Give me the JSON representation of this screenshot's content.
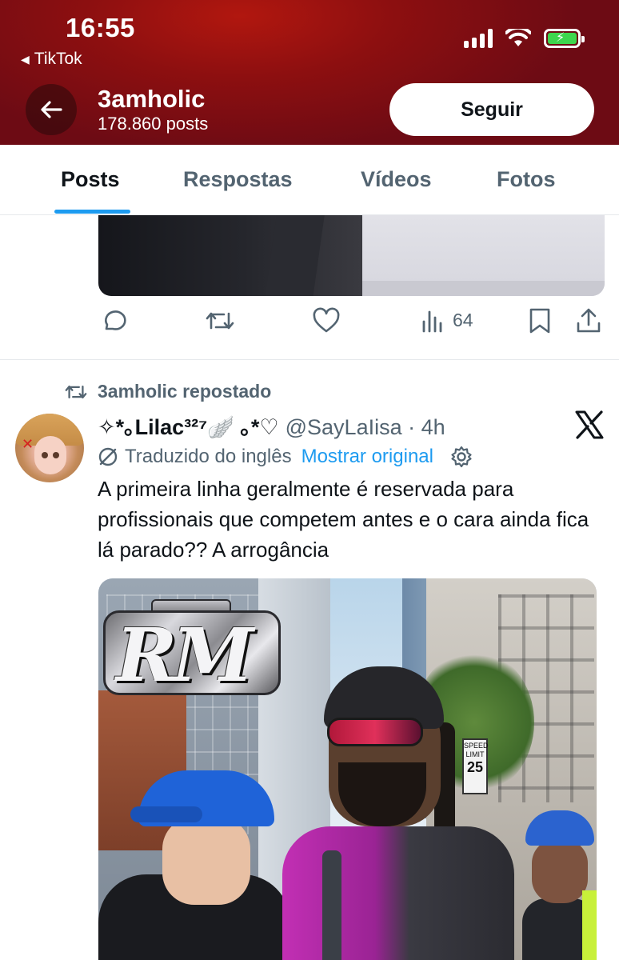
{
  "status_bar": {
    "time": "16:55",
    "back_app": "TikTok",
    "icons": [
      "cellular-signal-icon",
      "wifi-icon",
      "battery-charging-icon"
    ]
  },
  "header": {
    "back_icon": "arrow-left-icon",
    "name": "3amholic",
    "post_count": "178.860 posts",
    "follow_label": "Seguir"
  },
  "tabs": [
    {
      "label": "Posts",
      "active": true
    },
    {
      "label": "Respostas",
      "active": false
    },
    {
      "label": "Vídeos",
      "active": false
    },
    {
      "label": "Fotos",
      "active": false
    }
  ],
  "previous_post": {
    "actions": {
      "reply_icon": "reply-icon",
      "repost_icon": "repost-icon",
      "like_icon": "heart-icon",
      "views_icon": "views-icon",
      "views_count": "64",
      "bookmark_icon": "bookmark-icon",
      "share_icon": "share-icon"
    }
  },
  "post": {
    "repost_label": "3amholic repostado",
    "display_name": "✧*｡Lilac³²⁷🪽 ｡*♡",
    "handle_time": "@SayLaIisa · 4h",
    "translated_label": "Traduzido do inglês",
    "show_original": "Mostrar original",
    "text": "A primeira linha geralmente é reservada para profissionais que competem antes e o cara ainda fica lá parado?? A arrogância",
    "media": {
      "watermark": "RM",
      "sign_top": "SPEED LIMIT",
      "sign_value": "25"
    }
  },
  "colors": {
    "header_bg": "#8d0f10",
    "accent_blue": "#1d9bf0",
    "secondary_text": "#536471",
    "battery_green": "#3ed64d"
  }
}
